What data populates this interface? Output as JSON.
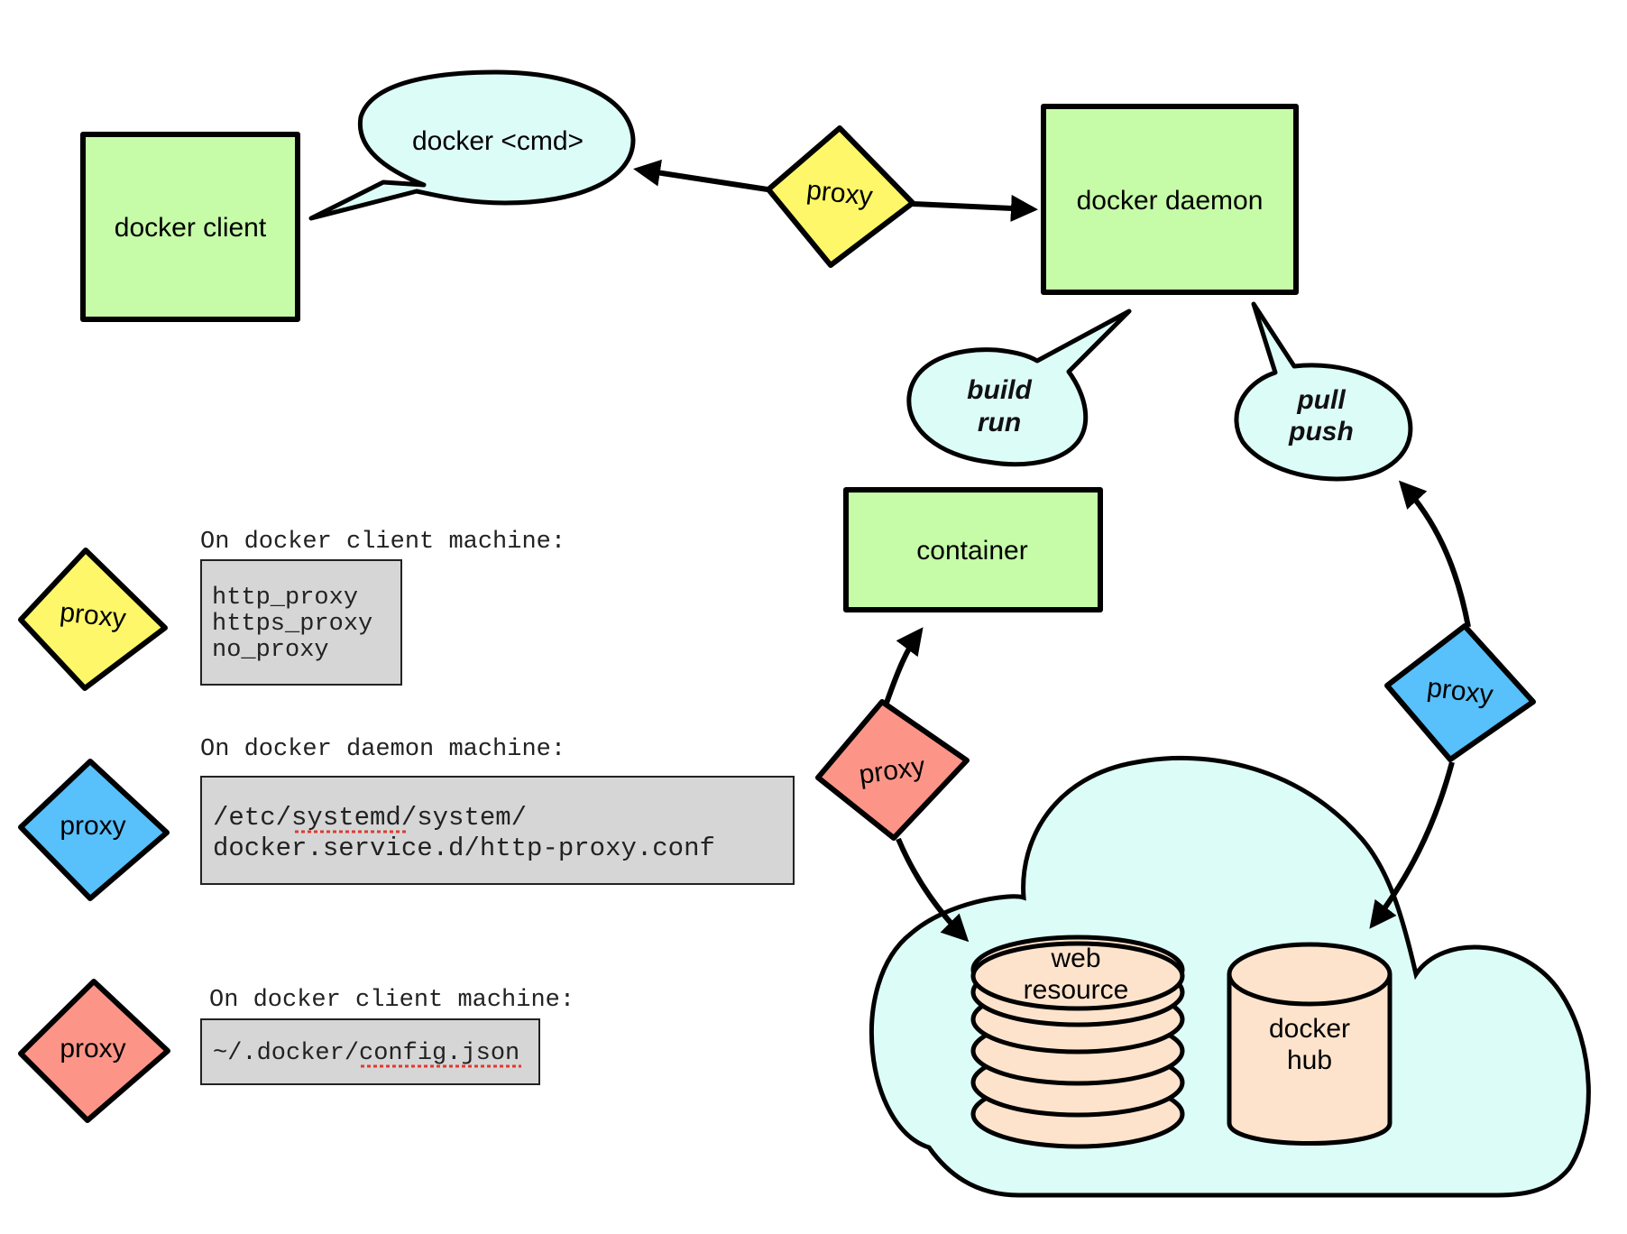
{
  "colors": {
    "box_green": "#c6fba8",
    "bubble_cyan": "#dcfcf8",
    "proxy_yellow": "#fdf769",
    "proxy_blue": "#58c0fa",
    "proxy_red": "#fc9588",
    "code_gray": "#d6d6d6",
    "cylinder_peach": "#fde3cc",
    "spell_underline": "#e03a2f"
  },
  "nodes": {
    "docker_client": "docker client",
    "docker_cmd": "docker <cmd>",
    "docker_daemon": "docker daemon",
    "container": "container",
    "web_resource": [
      "web",
      "resource"
    ],
    "docker_hub": [
      "docker",
      "hub"
    ]
  },
  "bubbles": {
    "build_run": [
      "build",
      "run"
    ],
    "pull_push": [
      "pull",
      "push"
    ]
  },
  "proxies": {
    "client_to_daemon": "proxy",
    "container_web": "proxy",
    "hub": "proxy"
  },
  "legend": [
    {
      "color": "yellow",
      "proxy_label": "proxy",
      "heading": "On docker client machine:",
      "lines": [
        "http_proxy",
        "https_proxy",
        "no_proxy"
      ]
    },
    {
      "color": "blue",
      "proxy_label": "proxy",
      "heading": "On docker daemon machine:",
      "lines": [
        "/etc/systemd/system/",
        "docker.service.d/http-proxy.conf"
      ],
      "misspelled_word": "systemd"
    },
    {
      "color": "red",
      "proxy_label": "proxy",
      "heading": "On docker client machine:",
      "lines": [
        "~/.docker/config.json"
      ],
      "misspelled_word": "config.json"
    }
  ]
}
